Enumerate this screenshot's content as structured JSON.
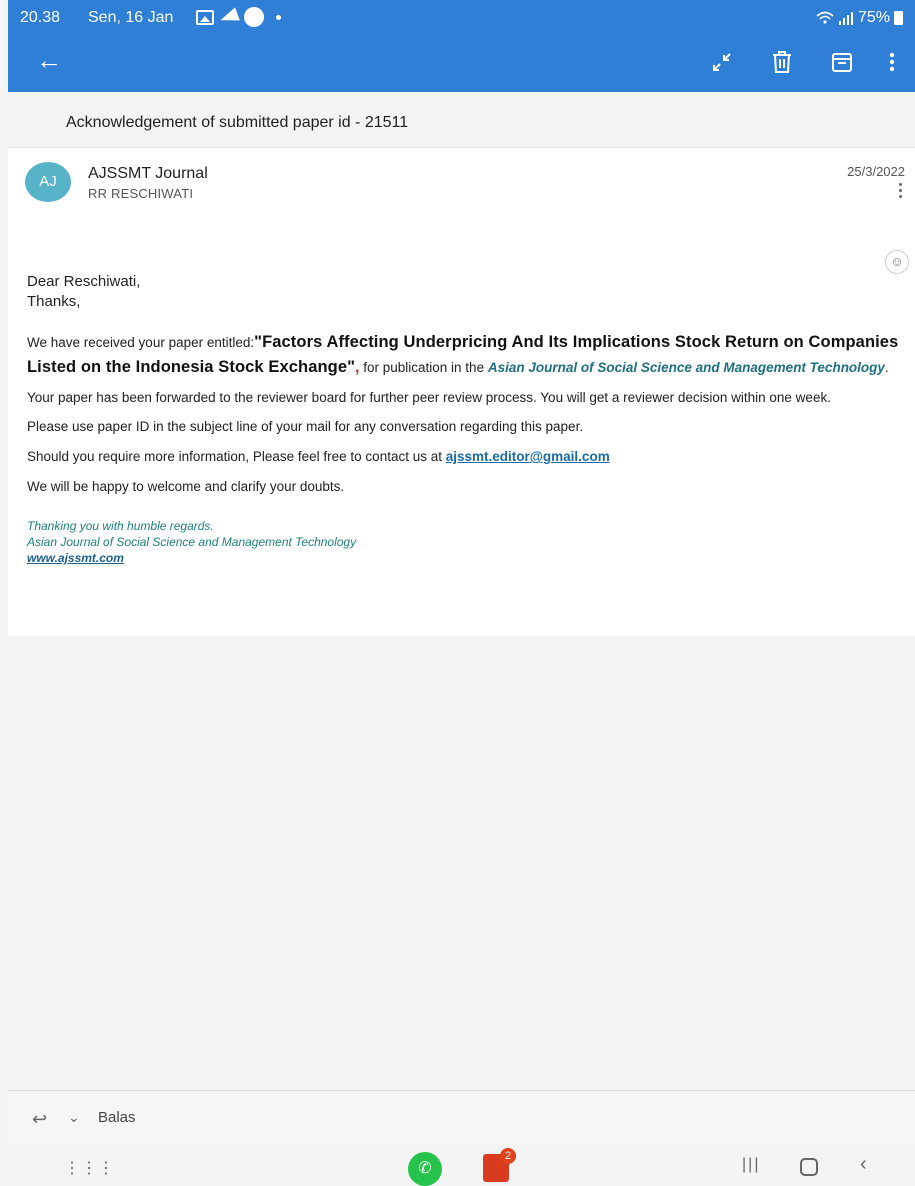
{
  "status": {
    "time": "20.38",
    "date": "Sen, 16 Jan",
    "battery": "75%",
    "icons": [
      "gallery-icon",
      "telegram-icon",
      "circle-icon",
      "dot-icon",
      "wifi-icon",
      "signal-icon",
      "battery-icon"
    ]
  },
  "toolbar": {
    "back_glyph": "←",
    "icons": [
      "collapse-icon",
      "trash-icon",
      "archive-icon",
      "more-icon"
    ],
    "accent": "#2f7fd6"
  },
  "subject": "Acknowledgement of submitted paper id - 21511",
  "email": {
    "avatar_initials": "AJ",
    "avatar_color": "#56b3c8",
    "sender": "AJSSMT Journal",
    "recipient": "RR RESCHIWATI",
    "date": "25/3/2022",
    "greeting": "Dear Reschiwati,",
    "thanks": "Thanks,",
    "received_prefix": "We have received your paper entitled:",
    "paper_title": "\"Factors Affecting Underpricing And Its Implications Stock Return on Companies Listed on the Indonesia Stock Exchange\"",
    "comma": ",",
    "publication_prefix": " for publication in the ",
    "journal_name": "Asian Journal of Social Science and Management Technology",
    "period": ".",
    "forwarded": "Your paper has been forwarded to the reviewer board for further peer review process. You will get a reviewer decision within one week.",
    "paper_id_note": "Please use paper ID in the subject line of your mail for any conversation regarding this paper.",
    "contact_prefix": "Should you require more information, Please feel free to contact us at ",
    "contact_email": "ajssmt.editor@gmail.com",
    "welcome": "We will be happy to welcome and clarify your doubts.",
    "sig_line1": "Thanking you with humble regards.",
    "sig_line2": "Asian Journal of Social Science and Management Technology",
    "sig_link": "www.ajssmt.com"
  },
  "reply": {
    "label": "Balas"
  },
  "nav": {
    "office_badge": "2"
  }
}
